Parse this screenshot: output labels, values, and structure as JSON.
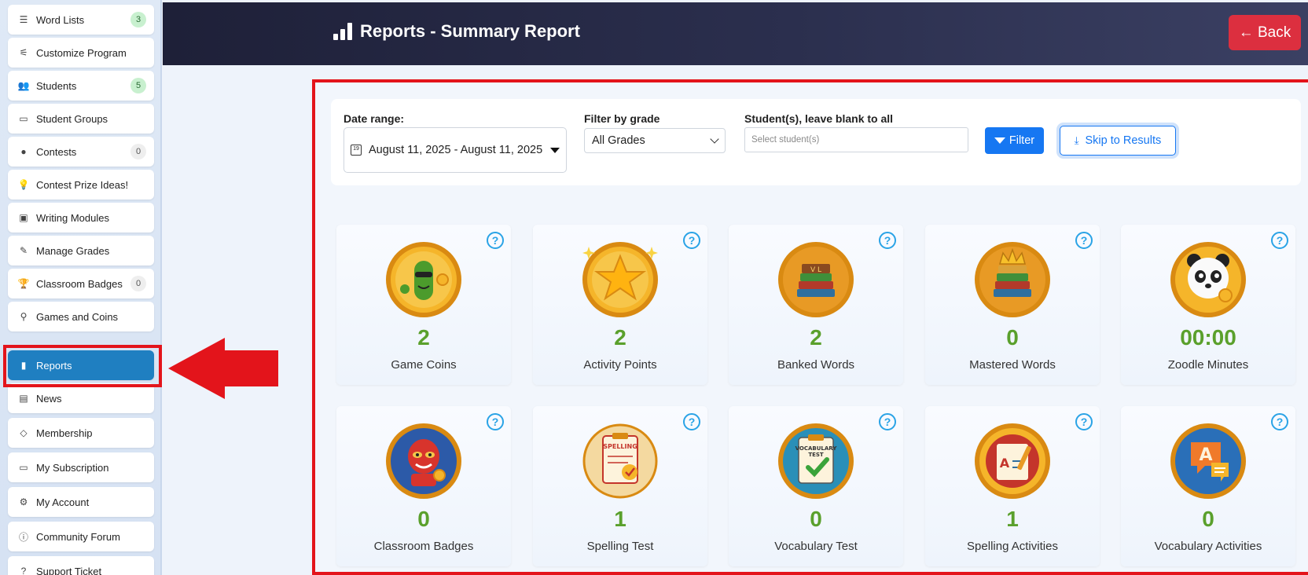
{
  "sidebar": {
    "items": [
      {
        "label": "Word Lists",
        "icon": "list-icon",
        "badge": "3",
        "badge_style": "green"
      },
      {
        "label": "Customize Program",
        "icon": "sliders-icon",
        "badge": "",
        "badge_style": ""
      },
      {
        "label": "Students",
        "icon": "users-icon",
        "badge": "5",
        "badge_style": "green"
      },
      {
        "label": "Student Groups",
        "icon": "layers-icon",
        "badge": "",
        "badge_style": ""
      },
      {
        "label": "Contests",
        "icon": "award-icon",
        "badge": "0",
        "badge_style": "grey"
      },
      {
        "label": "Contest Prize Ideas!",
        "icon": "lightbulb-icon",
        "badge": "",
        "badge_style": ""
      },
      {
        "label": "Writing Modules",
        "icon": "terminal-icon",
        "badge": "",
        "badge_style": ""
      },
      {
        "label": "Manage Grades",
        "icon": "edit-icon",
        "badge": "",
        "badge_style": ""
      },
      {
        "label": "Classroom Badges",
        "icon": "trophy-icon",
        "badge": "0",
        "badge_style": "grey"
      },
      {
        "label": "Games and Coins",
        "icon": "joystick-icon",
        "badge": "",
        "badge_style": ""
      },
      {
        "label": "Reports",
        "icon": "bar-chart-icon",
        "badge": "",
        "badge_style": "",
        "active": true
      },
      {
        "label": "News",
        "icon": "newspaper-icon",
        "badge": "",
        "badge_style": ""
      },
      {
        "label": "Membership",
        "icon": "gem-icon",
        "badge": "",
        "badge_style": ""
      },
      {
        "label": "My Subscription",
        "icon": "credit-card-icon",
        "badge": "",
        "badge_style": ""
      },
      {
        "label": "My Account",
        "icon": "gear-icon",
        "badge": "",
        "badge_style": ""
      },
      {
        "label": "Community Forum",
        "icon": "info-icon",
        "badge": "",
        "badge_style": ""
      },
      {
        "label": "Support Ticket",
        "icon": "help-circle-icon",
        "badge": "",
        "badge_style": ""
      }
    ]
  },
  "header": {
    "title": "Reports - Summary Report",
    "back_label": "← Back"
  },
  "filters": {
    "date_range_label": "Date range:",
    "date_range_value": "August 11, 2025 - August 11, 2025",
    "grade_label": "Filter by grade",
    "grade_value": "All Grades",
    "students_label": "Student(s), leave blank to all",
    "students_placeholder": "Select student(s)",
    "filter_button": "Filter",
    "skip_button": "Skip to Results"
  },
  "stats": [
    {
      "value": "2",
      "caption": "Game Coins",
      "medal": "cactus-coin-icon"
    },
    {
      "value": "2",
      "caption": "Activity Points",
      "medal": "star-coin-icon"
    },
    {
      "value": "2",
      "caption": "Banked Words",
      "medal": "books-coin-icon"
    },
    {
      "value": "0",
      "caption": "Mastered Words",
      "medal": "crowned-books-coin-icon"
    },
    {
      "value": "00:00",
      "caption": "Zoodle Minutes",
      "medal": "panda-coin-icon"
    },
    {
      "value": "0",
      "caption": "Classroom Badges",
      "medal": "luchador-coin-icon"
    },
    {
      "value": "1",
      "caption": "Spelling Test",
      "medal": "spelling-clipboard-icon"
    },
    {
      "value": "0",
      "caption": "Vocabulary Test",
      "medal": "vocab-clipboard-icon"
    },
    {
      "value": "1",
      "caption": "Spelling Activities",
      "medal": "spelling-notebook-icon"
    },
    {
      "value": "0",
      "caption": "Vocabulary Activities",
      "medal": "speech-bubble-coin-icon"
    }
  ],
  "colors": {
    "accent_blue": "#1677f2",
    "active_nav": "#1f7fc1",
    "back_red": "#dc2f3f",
    "highlight_red": "#e3141b",
    "stat_green": "#5aa02c",
    "help_blue": "#2aa3e6"
  }
}
